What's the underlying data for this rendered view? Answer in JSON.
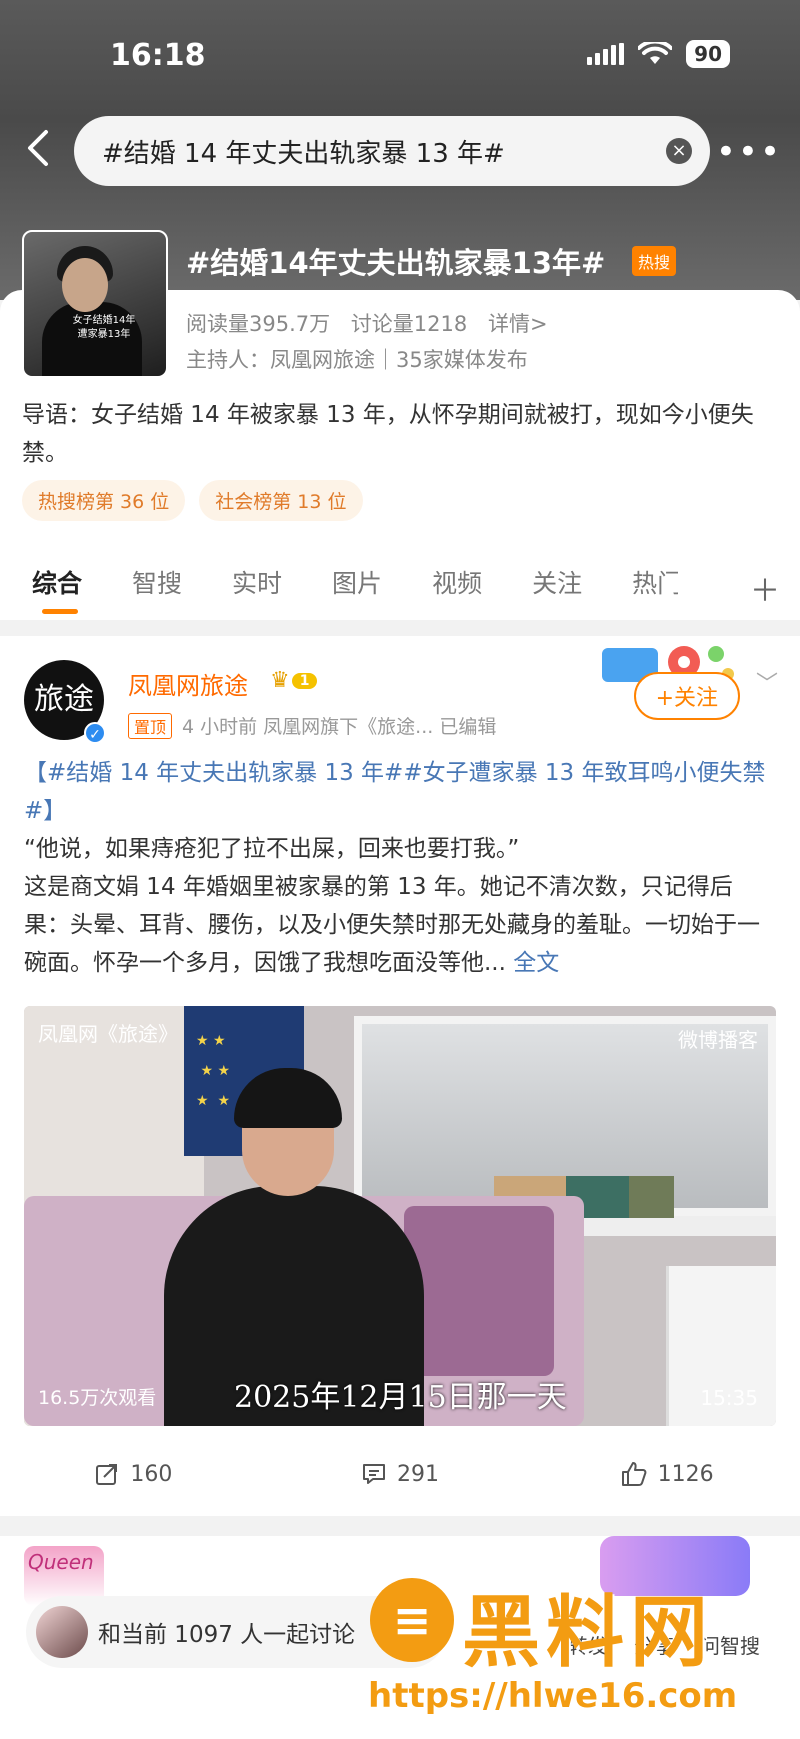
{
  "status": {
    "time": "16:18",
    "battery": "90"
  },
  "search": {
    "query": "#结婚 14 年丈夫出轨家暴 13 年#"
  },
  "topic": {
    "title": "#结婚14年丈夫出轨家暴13年#",
    "hot_badge": "热搜",
    "thumb_caption": "女子结婚14年\n遭家暴13年",
    "reads": "阅读量395.7万",
    "discussions": "讨论量1218",
    "details": "详情>",
    "host": "主持人：凤凰网旅途｜35家媒体发布",
    "intro": "导语：女子结婚 14 年被家暴 13 年，从怀孕期间就被打，现如今小便失禁。",
    "rank_tags": [
      "热搜榜第 36 位",
      "社会榜第 13 位"
    ]
  },
  "tabs": [
    "综合",
    "智搜",
    "实时",
    "图片",
    "视频",
    "关注",
    "热门"
  ],
  "post": {
    "avatar_text": "旅途",
    "username": "凤凰网旅途",
    "level": "1",
    "pin_label": "置顶",
    "meta": "4 小时前  凤凰网旗下《旅途... 已编辑",
    "follow_label": "+关注",
    "hashtags": "【#结婚 14 年丈夫出轨家暴 13 年##女子遭家暴 13 年致耳鸣小便失禁#】",
    "quote": "“他说，如果痔疮犯了拉不出屎，回来也要打我。”",
    "body": "这是商文娟 14 年婚姻里被家暴的第 13 年。她记不清次数，只记得后果：头晕、耳背、腰伤，以及小便失禁时那无处藏身的羞耻。一切始于一碗面。怀孕一个多月，因饿了我想吃面没等他...",
    "full_text": "全文",
    "video": {
      "logo": "凤凰网《旅途》",
      "platform": "微博播客",
      "views": "16.5万次观看",
      "caption": "2025年12月15日那一天",
      "duration": "15:35"
    },
    "reposts": "160",
    "comments": "291",
    "likes": "1126"
  },
  "discuss": {
    "text": "和当前 1097 人一起讨论"
  },
  "bottom_actions": [
    "转发",
    "分享",
    "问智搜"
  ],
  "watermark": {
    "name": "黑料网",
    "url": "https://hlwe16.com"
  },
  "colors": {
    "accent": "#ff8200",
    "link": "#4877b5",
    "watermark": "#f39c12"
  }
}
